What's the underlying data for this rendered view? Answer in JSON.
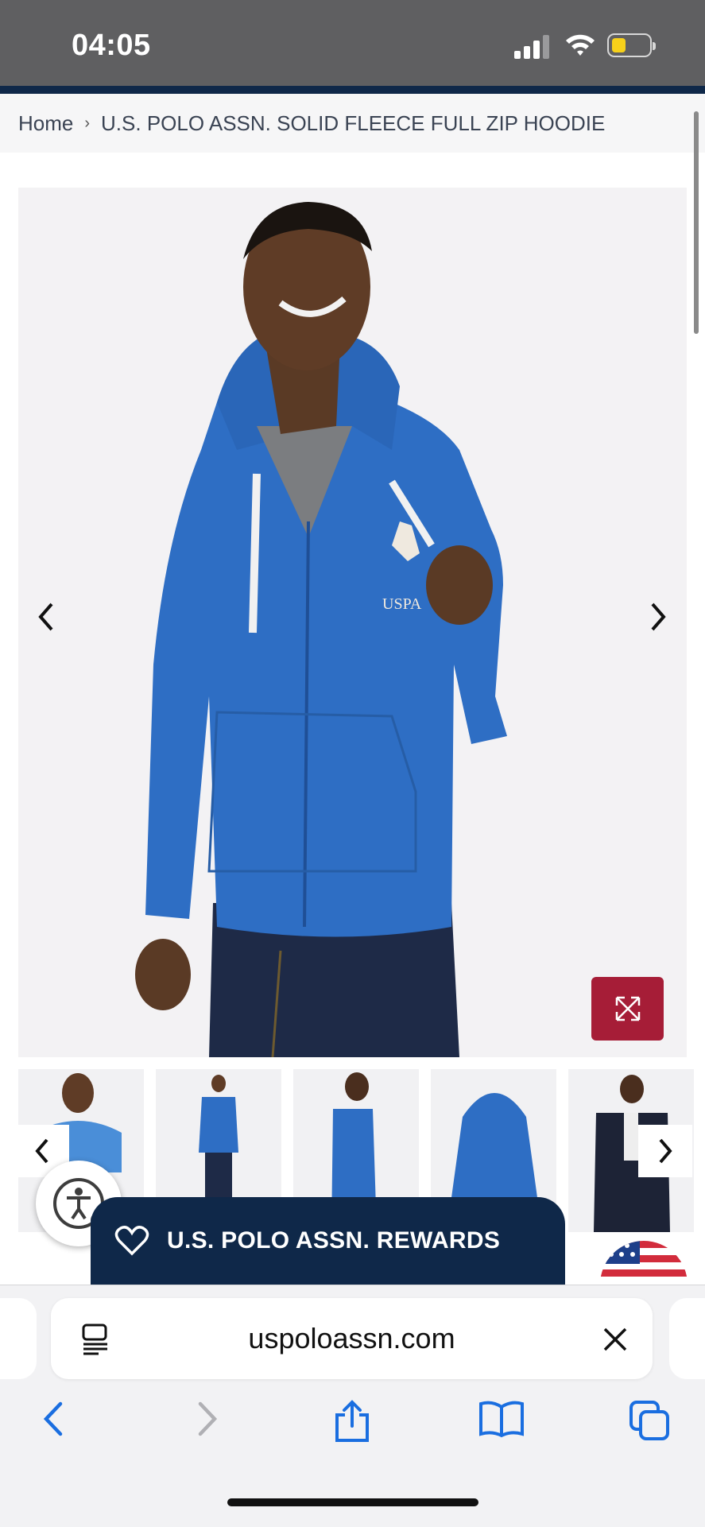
{
  "status_bar": {
    "time": "04:05"
  },
  "breadcrumb": {
    "home": "Home",
    "separator": "›",
    "current": "U.S. POLO ASSN. SOLID FLEECE FULL ZIP HOODIE"
  },
  "product": {
    "logo_text": "USPA",
    "thumbnail_count": 5,
    "colors": {
      "hoodie": "#2e6ec4",
      "navy": "#0f2849",
      "accent": "#a61d37"
    }
  },
  "rewards": {
    "label": "U.S. POLO ASSN. REWARDS"
  },
  "browser": {
    "url": "uspoloassn.com"
  },
  "icons": [
    "signal-icon",
    "wifi-icon",
    "battery-icon",
    "chevron-left-icon",
    "chevron-right-icon",
    "expand-icon",
    "accessibility-icon",
    "heart-icon",
    "flag-icon",
    "reader-icon",
    "close-icon",
    "back-icon",
    "forward-icon",
    "share-icon",
    "bookmarks-icon",
    "tabs-icon"
  ]
}
